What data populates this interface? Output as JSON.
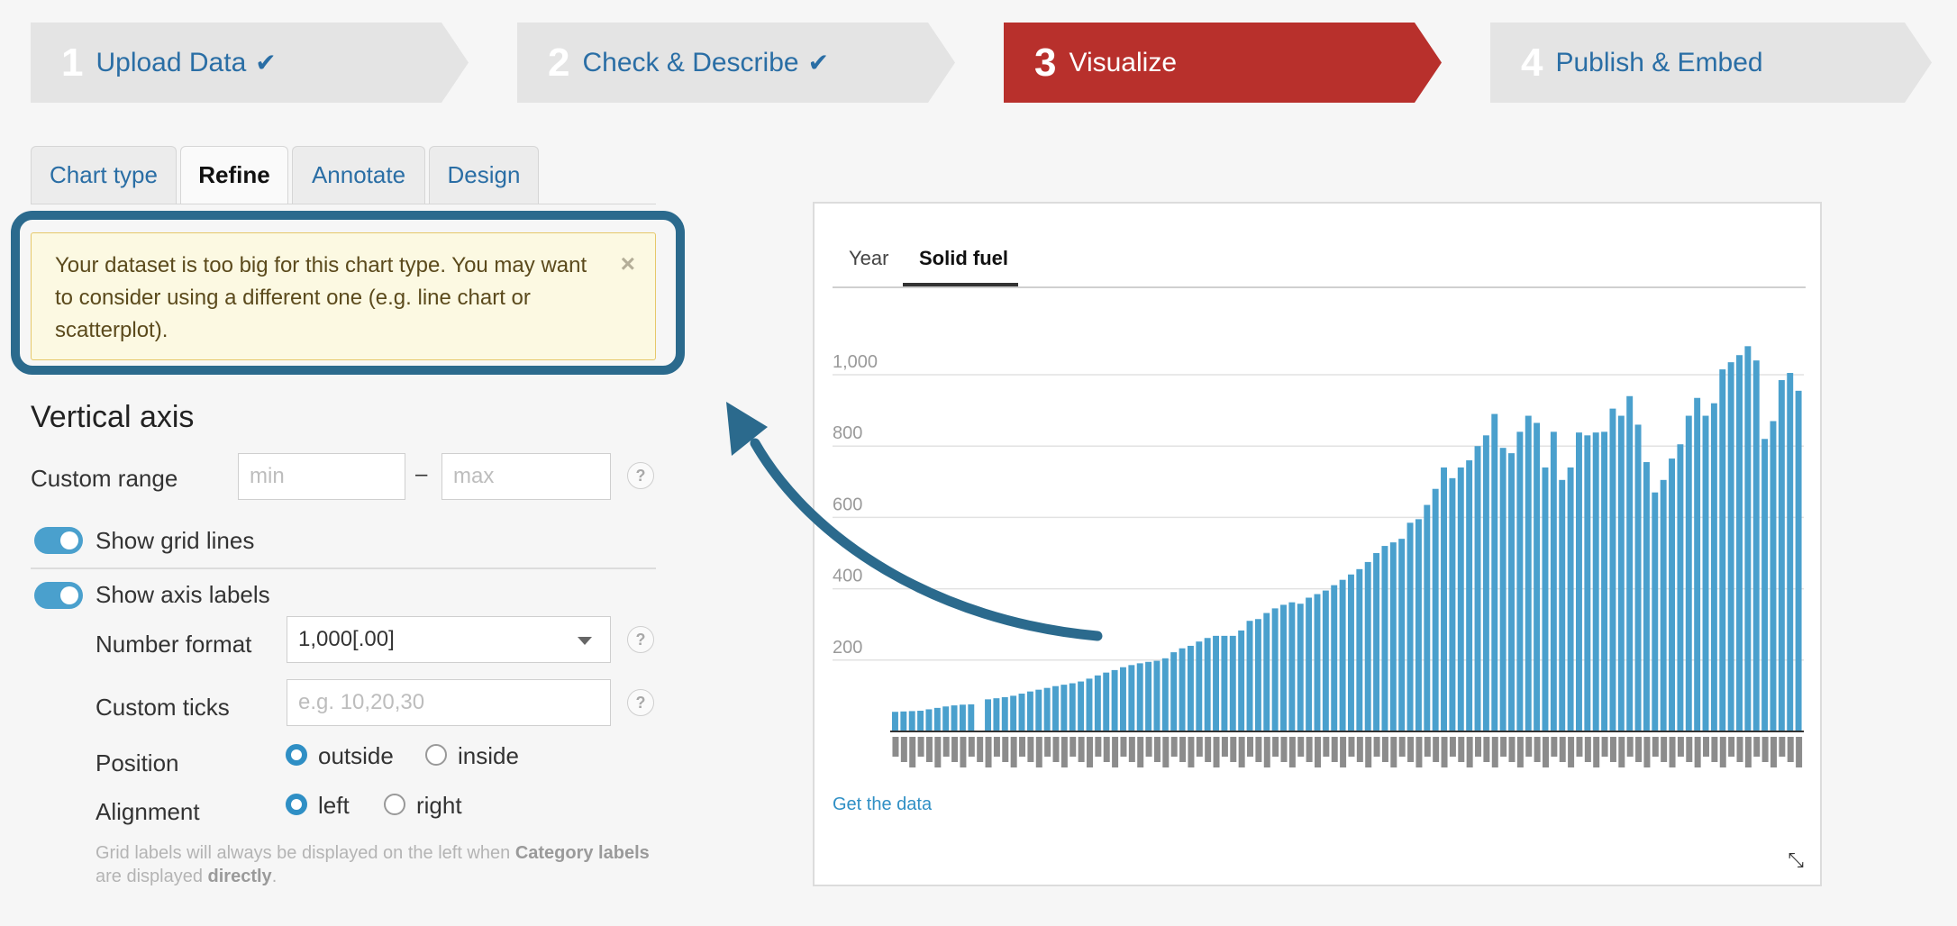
{
  "steps": [
    {
      "num": "1",
      "label": "Upload Data",
      "done": true
    },
    {
      "num": "2",
      "label": "Check & Describe",
      "done": true
    },
    {
      "num": "3",
      "label": "Visualize",
      "done": false
    },
    {
      "num": "4",
      "label": "Publish & Embed",
      "done": false
    }
  ],
  "check_glyph": "✔",
  "tabs": [
    "Chart type",
    "Refine",
    "Annotate",
    "Design"
  ],
  "alert": {
    "text": "Your dataset is too big for this chart type. You may want to consider using a different one (e.g. line chart or scatterplot).",
    "close": "×"
  },
  "vertical_axis": {
    "title": "Vertical axis",
    "custom_range_label": "Custom range",
    "min_placeholder": "min",
    "max_placeholder": "max",
    "range_dash": "–",
    "help": "?",
    "show_grid_lines": "Show grid lines",
    "show_axis_labels": "Show axis labels",
    "number_format_label": "Number format",
    "number_format_value": "1,000[.00]",
    "custom_ticks_label": "Custom ticks",
    "custom_ticks_placeholder": "e.g. 10,20,30",
    "position_label": "Position",
    "position_options": [
      "outside",
      "inside"
    ],
    "alignment_label": "Alignment",
    "alignment_options": [
      "left",
      "right"
    ],
    "note_prefix": "Grid labels will always be displayed on the left when ",
    "note_bold1": "Category labels",
    "note_mid": " are displayed ",
    "note_bold2": "directly",
    "note_end": "."
  },
  "preview": {
    "tabs": [
      "Year",
      "Solid fuel"
    ],
    "get_data": "Get the data",
    "resize_icon": "⤡"
  },
  "chart_data": {
    "type": "bar",
    "yticks": [
      "200",
      "400",
      "600",
      "800",
      "1,000"
    ],
    "ylim": [
      0,
      1050
    ],
    "color": "#4aa0cd",
    "values": [
      55,
      56,
      57,
      58,
      62,
      66,
      70,
      73,
      75,
      76,
      0,
      90,
      93,
      96,
      100,
      106,
      112,
      117,
      122,
      127,
      131,
      135,
      140,
      148,
      157,
      165,
      172,
      180,
      186,
      191,
      195,
      198,
      205,
      222,
      233,
      240,
      252,
      262,
      268,
      268,
      268,
      283,
      310,
      315,
      332,
      345,
      355,
      362,
      358,
      375,
      385,
      395,
      410,
      425,
      440,
      455,
      475,
      500,
      520,
      530,
      540,
      585,
      595,
      635,
      680,
      740,
      710,
      740,
      760,
      800,
      830,
      890,
      795,
      780,
      840,
      885,
      865,
      740,
      840,
      705,
      740,
      838,
      830,
      838,
      840,
      905,
      885,
      940,
      860,
      755,
      670,
      705,
      765,
      805,
      885,
      935,
      885,
      920,
      1015,
      1035,
      1055,
      1080,
      1040,
      820,
      870,
      985,
      1005,
      955
    ]
  }
}
